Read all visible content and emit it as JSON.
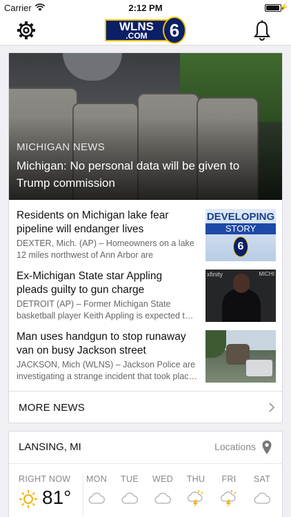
{
  "status_bar": {
    "carrier": "Carrier",
    "time": "2:12 PM",
    "battery_level": 0.95
  },
  "header": {
    "logo_top": "WLNS",
    "logo_bottom": ".COM",
    "logo_number": "6"
  },
  "hero": {
    "kicker": "MICHIGAN NEWS",
    "headline": "Michigan: No personal data will be given to Trump commission"
  },
  "stories": [
    {
      "title": "Residents on Michigan lake fear pipeline will endanger lives",
      "desc": "DEXTER, Mich. (AP) – Homeowners on a lake 12 miles northwest of Ann Arbor are concerned…",
      "thumb_text_1": "DEVELOPING",
      "thumb_text_2": "STORY",
      "thumb_text_3": "6"
    },
    {
      "title": "Ex-Michigan State star Appling pleads guilty to gun charge",
      "desc": "DETROIT (AP) – Former Michigan State basketball player Keith Appling is expected t…",
      "thumb_text_1": "xfinity",
      "thumb_text_2": "MICHI"
    },
    {
      "title": "Man uses handgun to stop runaway van on busy Jackson street",
      "desc": "JACKSON, Mich (WLNS) – Jackson Police are investigating a strange incident that took plac…"
    }
  ],
  "more_news": {
    "label": "MORE NEWS"
  },
  "weather": {
    "city": "LANSING, MI",
    "locations_label": "Locations",
    "now_label": "RIGHT NOW",
    "now_temp": "81°",
    "days": [
      {
        "label": "MON",
        "icon": "cloud-icon"
      },
      {
        "label": "TUE",
        "icon": "cloud-icon"
      },
      {
        "label": "WED",
        "icon": "cloud-icon"
      },
      {
        "label": "THU",
        "icon": "thunderstorm-icon"
      },
      {
        "label": "FRI",
        "icon": "thunderstorm-icon"
      },
      {
        "label": "SAT",
        "icon": "cloud-icon"
      }
    ]
  }
}
